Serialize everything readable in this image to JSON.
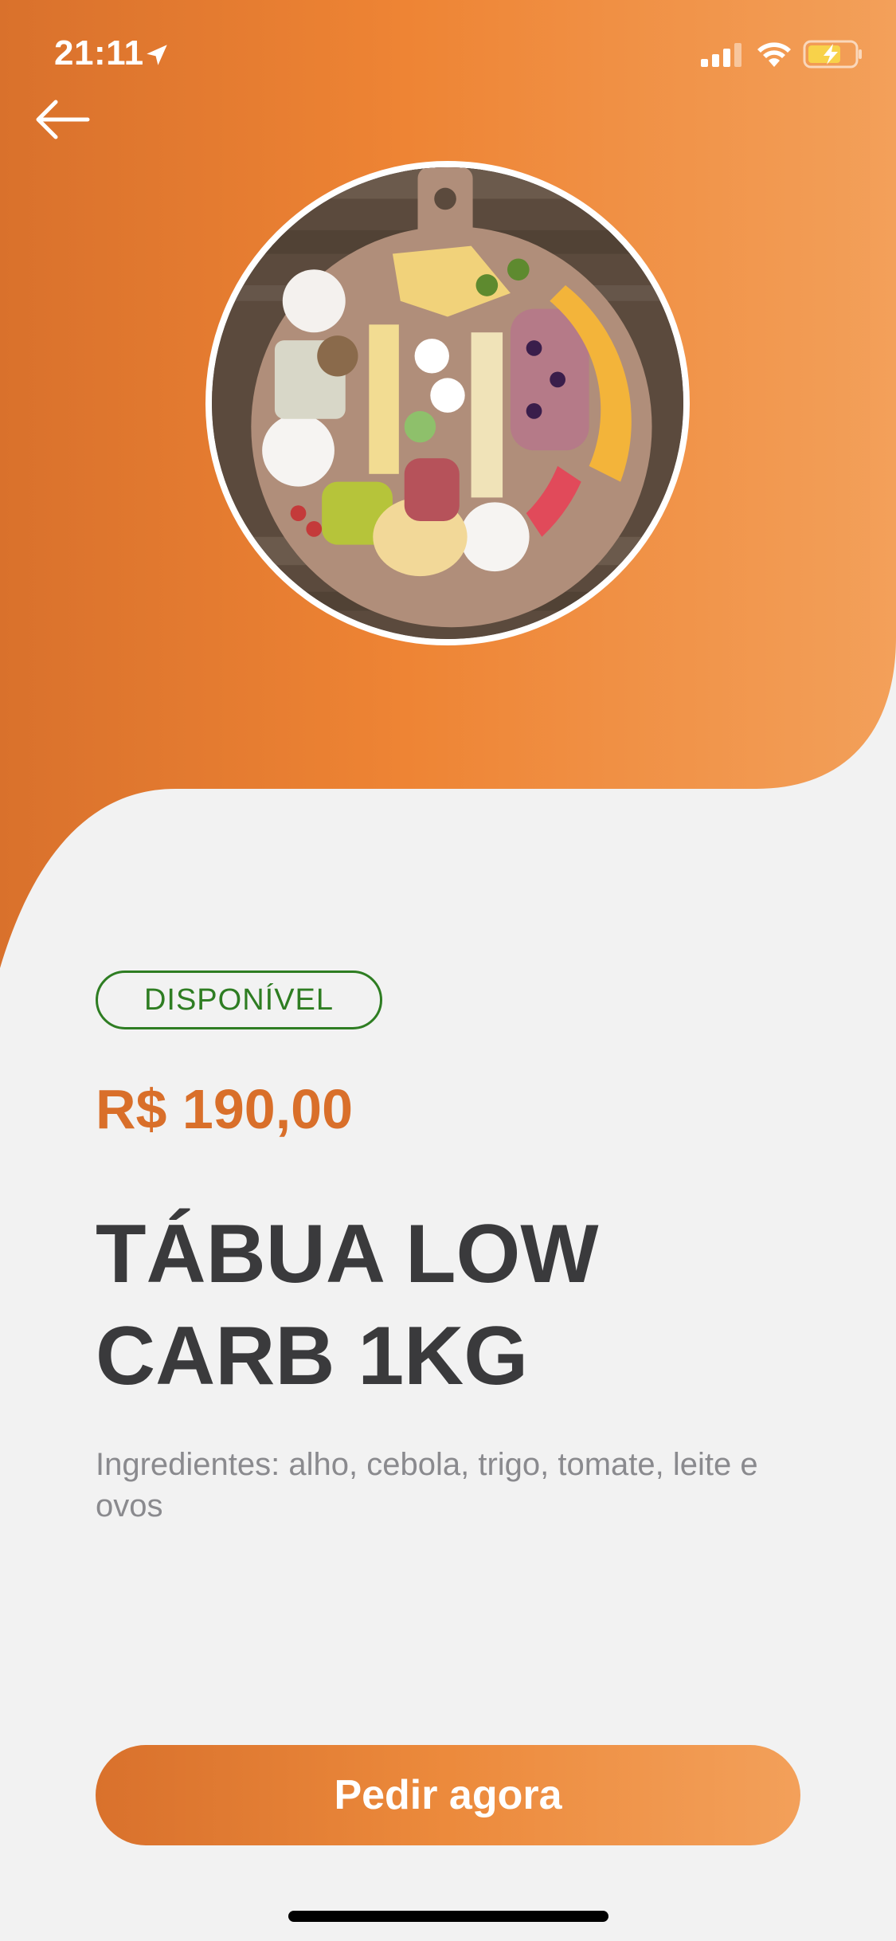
{
  "status_bar": {
    "time": "21:11"
  },
  "product": {
    "availability": "DISPONÍVEL",
    "price": "R$ 190,00",
    "title_line1": "TÁBUA LOW",
    "title_line2": "CARB 1KG",
    "ingredients": "Ingredientes: alho, cebola, trigo, tomate, leite e ovos",
    "image_alt": "Tábua de frios"
  },
  "actions": {
    "order_label": "Pedir agora"
  },
  "icons": {
    "back": "arrow-left-icon",
    "location": "location-arrow-icon",
    "signal": "cellular-signal-icon",
    "wifi": "wifi-icon",
    "battery": "battery-charging-icon"
  },
  "colors": {
    "accent_dark": "#d96f2a",
    "accent_light": "#f3a05a",
    "available": "#2e7d22",
    "title": "#3a3a3c",
    "muted": "#8a8a8e",
    "background": "#f2f2f2"
  }
}
